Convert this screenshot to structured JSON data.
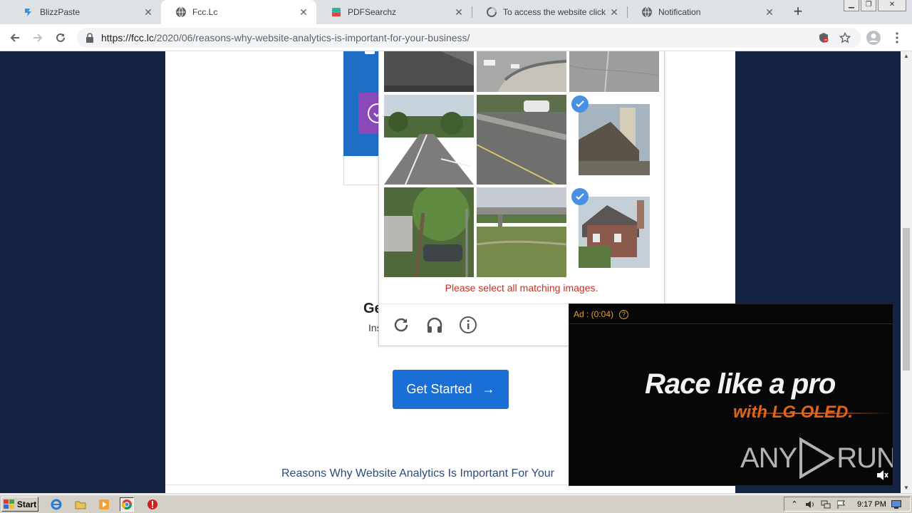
{
  "browser": {
    "tabs": [
      {
        "title": "BlizzPaste",
        "icon": "blizzpaste-icon",
        "active": false
      },
      {
        "title": "Fcc.Lc",
        "icon": "globe-icon",
        "active": true
      },
      {
        "title": "PDFSearchz",
        "icon": "pdfsearchz-icon",
        "active": false
      },
      {
        "title": "To access the website click the '",
        "icon": "loading-globe-icon",
        "active": false
      },
      {
        "title": "Notification",
        "icon": "globe-icon",
        "active": false
      }
    ],
    "new_tab_label": "+",
    "close_glyph": "✕",
    "url_host": "https://fcc.lc",
    "url_path": "/2020/06/reasons-why-website-analytics-is-important-for-your-business/"
  },
  "page": {
    "heading_partial": "Ge",
    "sub_partial": "Ins",
    "cta_label": "Get Started",
    "cta_arrow": "→",
    "footer_link": "Reasons Why Website Analytics Is Important For Your"
  },
  "captcha": {
    "error_message": "Please select all matching images.",
    "tiles": [
      {
        "content": "roof-corner",
        "selected": false
      },
      {
        "content": "highway-overpass-cars",
        "selected": false
      },
      {
        "content": "road-surface",
        "selected": false
      },
      {
        "content": "road-with-trees",
        "selected": false
      },
      {
        "content": "highway-with-car",
        "selected": false
      },
      {
        "content": "house-with-chimney",
        "selected": true
      },
      {
        "content": "tree-and-car",
        "selected": false
      },
      {
        "content": "overpass-grass",
        "selected": false
      },
      {
        "content": "brick-house",
        "selected": true
      }
    ],
    "footer_icons": [
      "reload-icon",
      "audio-icon",
      "info-icon"
    ]
  },
  "ad": {
    "label": "Ad : (0:04)",
    "help": "?",
    "title": "Race like a pro",
    "subtitle": "with LG OLED.",
    "watermark": "ANY",
    "watermark_end": "RUN",
    "accent": "#e6a236"
  },
  "taskbar": {
    "start_label": "Start",
    "clock": "9:17 PM"
  }
}
